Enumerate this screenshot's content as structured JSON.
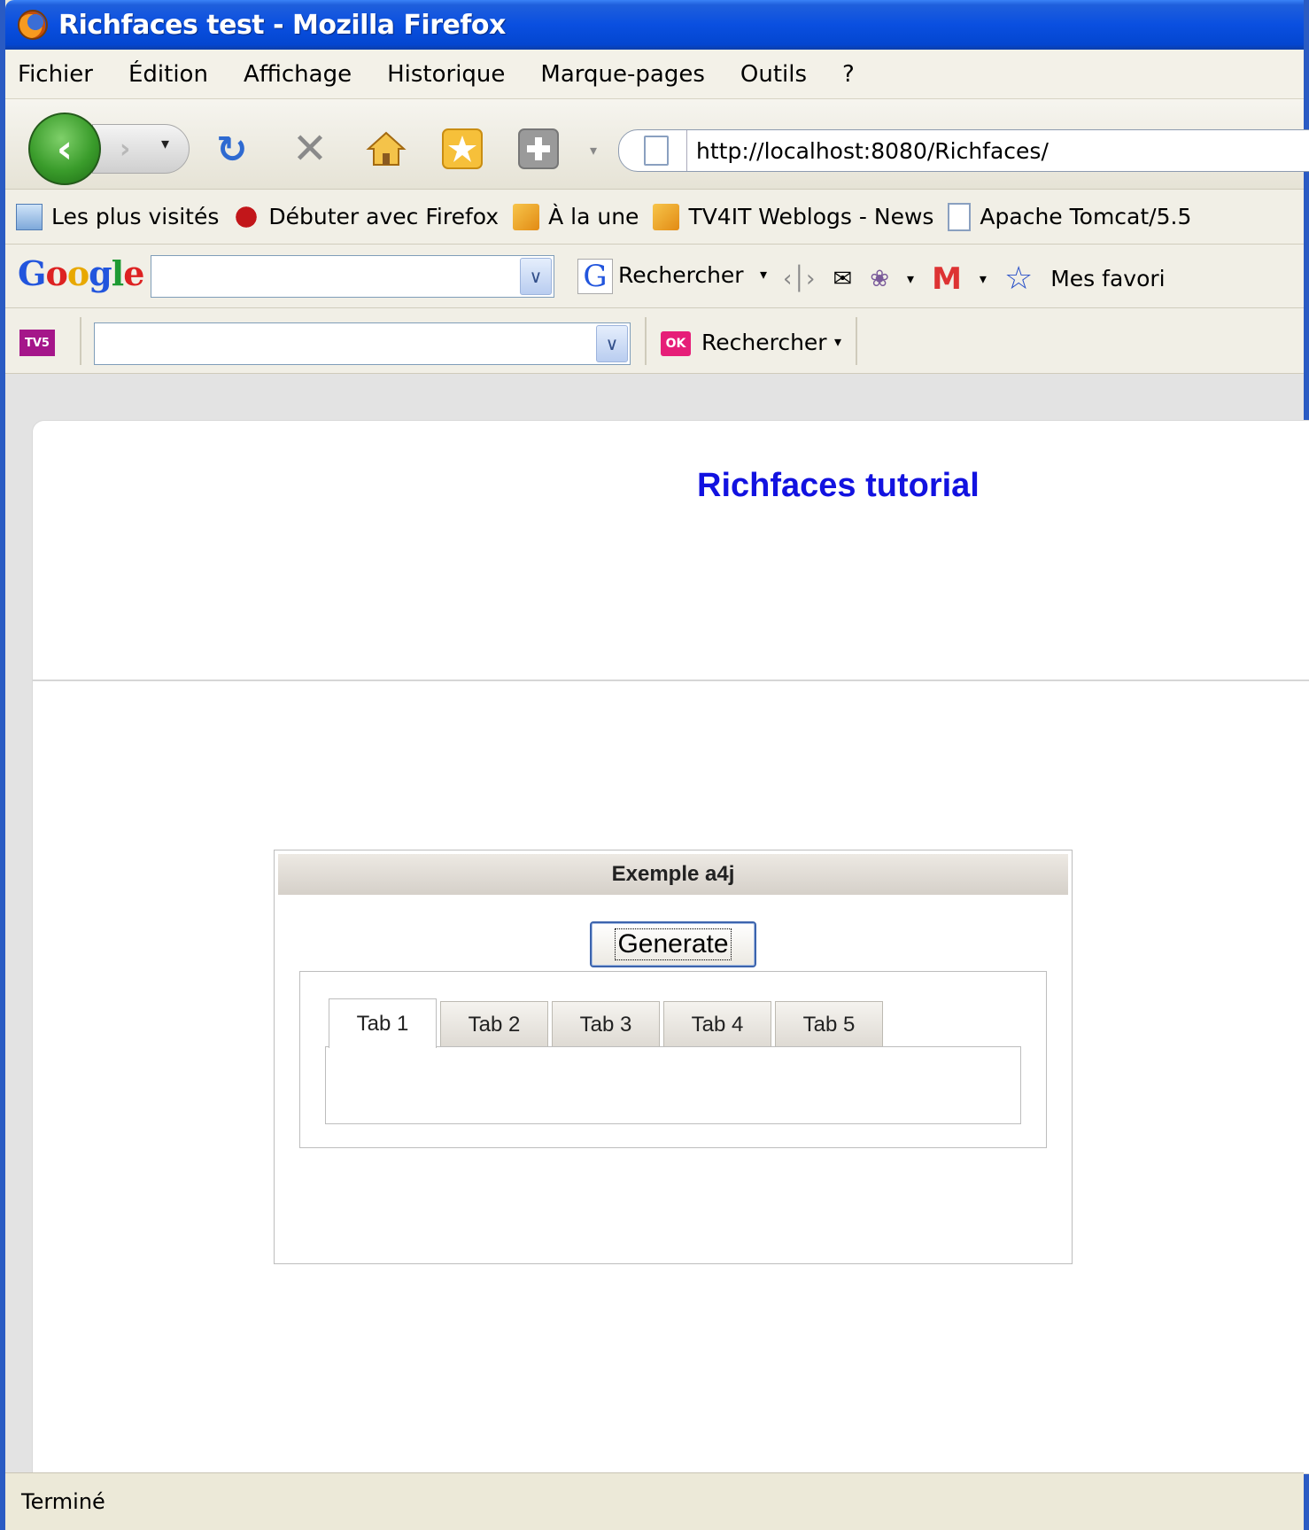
{
  "window": {
    "title": "Richfaces test - Mozilla Firefox"
  },
  "menu": {
    "items": [
      "Fichier",
      "Édition",
      "Affichage",
      "Historique",
      "Marque-pages",
      "Outils",
      "?"
    ]
  },
  "navigation": {
    "url": "http://localhost:8080/Richfaces/"
  },
  "bookmarks": {
    "items": [
      {
        "label": "Les plus visités",
        "icon": "most-visited-icon"
      },
      {
        "label": "Débuter avec Firefox",
        "icon": "firefox-dino-icon"
      },
      {
        "label": "À la une",
        "icon": "rss-icon"
      },
      {
        "label": "TV4IT Weblogs - News",
        "icon": "rss-icon"
      },
      {
        "label": "Apache Tomcat/5.5",
        "icon": "page-icon"
      }
    ]
  },
  "google_toolbar": {
    "logo": "Google",
    "search_value": "",
    "search_button": "Rechercher",
    "favorites_label": "Mes favori"
  },
  "tv5_toolbar": {
    "logo": "TV5",
    "search_value": "",
    "ok_label": "OK",
    "search_button": "Rechercher"
  },
  "page": {
    "title": "Richfaces tutorial",
    "panel": {
      "header": "Exemple a4j",
      "generate_button": "Generate",
      "tabs": [
        "Tab 1",
        "Tab 2",
        "Tab 3",
        "Tab 4",
        "Tab 5"
      ],
      "active_tab": "Tab 1"
    }
  },
  "status": {
    "text": "Terminé"
  },
  "colors": {
    "title_bar": "#0a4fe0",
    "page_title": "#1212e0",
    "chrome": "#ece9d8"
  }
}
